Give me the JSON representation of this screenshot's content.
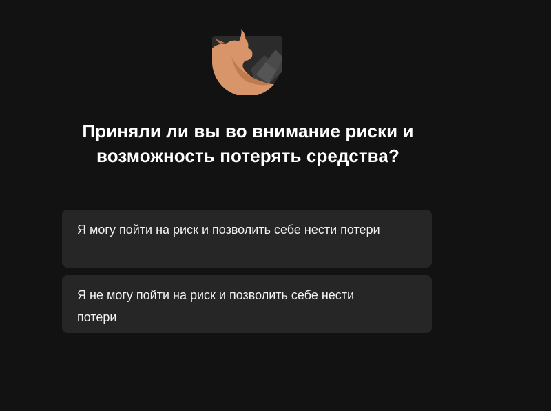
{
  "logo": {
    "icon": "bull-icon",
    "colors": {
      "bull": "#d9956a",
      "bull_shade": "#c07a4f",
      "badge": "#2e2e2e",
      "badge_light": "#4a4a4a"
    }
  },
  "question": {
    "text": "Приняли ли вы во внимание риски и возможность потерять средства?"
  },
  "options": [
    {
      "label": "Я могу пойти на риск и позволить себе нести потери"
    },
    {
      "label": "Я не могу пойти на риск и позволить себе нести потери"
    }
  ],
  "colors": {
    "background": "#121212",
    "option_background": "#262626",
    "text": "#ffffff"
  }
}
